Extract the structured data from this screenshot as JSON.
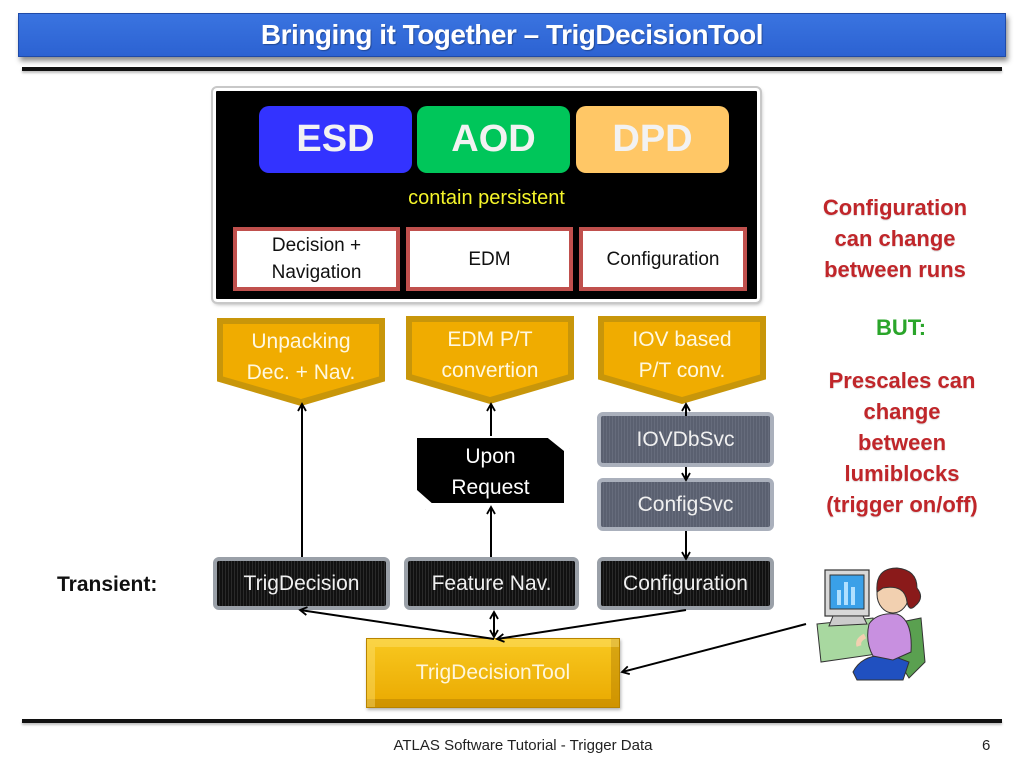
{
  "slide": {
    "title": "Bringing it Together – TrigDecisionTool",
    "footer": "ATLAS Software Tutorial - Trigger Data",
    "page_number": "6"
  },
  "persistent": {
    "formats": [
      {
        "label": "ESD",
        "color": "#3333ff"
      },
      {
        "label": "AOD",
        "color": "#00c65a"
      },
      {
        "label": "DPD",
        "color": "#ffc766"
      }
    ],
    "caption": "contain persistent",
    "contents": [
      "Decision +\nNavigation",
      "EDM",
      "Configuration"
    ]
  },
  "converters": [
    {
      "line1": "Unpacking",
      "line2": "Dec. + Nav."
    },
    {
      "line1": "EDM P/T",
      "line2": "convertion"
    },
    {
      "line1": "IOV based",
      "line2": "P/T conv."
    }
  ],
  "request": {
    "line1": "Upon",
    "line2": "Request"
  },
  "services": [
    "IOVDbSvc",
    "ConfigSvc"
  ],
  "transient": {
    "label": "Transient:",
    "objects": [
      "TrigDecision",
      "Feature Nav.",
      "Configuration"
    ]
  },
  "tool": {
    "label": "TrigDecisionTool"
  },
  "notes": {
    "config": [
      "Configuration",
      "can change",
      "between runs"
    ],
    "but": "BUT:",
    "prescale": [
      "Prescales can",
      "change",
      "between",
      "lumiblocks",
      "(trigger on/off)"
    ]
  },
  "colors": {
    "title_bar": "#3a74e0",
    "converter": "#f0ac00",
    "note_red": "#c0262a",
    "but_green": "#2aa52a",
    "caption_yellow": "#f5f52a"
  }
}
